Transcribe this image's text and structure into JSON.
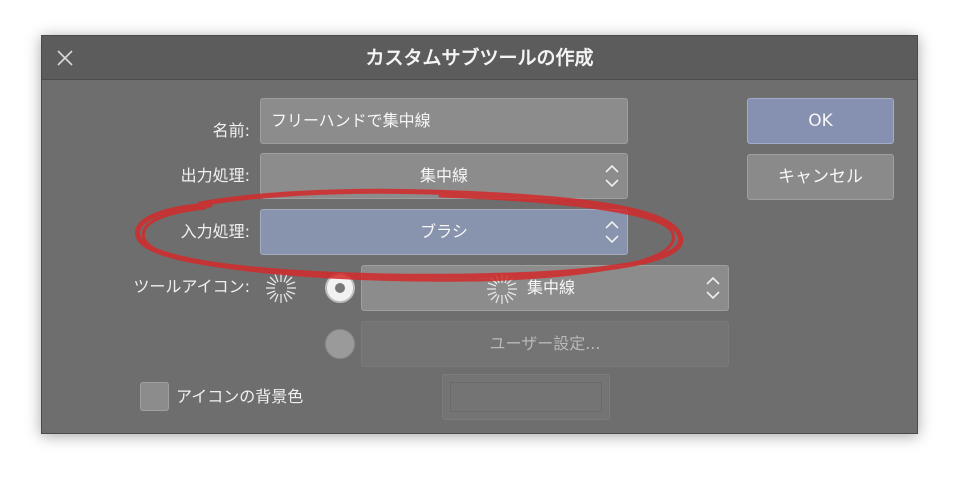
{
  "dialog": {
    "title": "カスタムサブツールの作成"
  },
  "form": {
    "name_label": "名前:",
    "name_value": "フリーハンドで集中線",
    "output_label": "出力処理:",
    "output_value": "集中線",
    "input_label": "入力処理:",
    "input_value": "ブラシ",
    "tool_icon_label": "ツールアイコン:",
    "icon_select_value": "集中線",
    "user_setting_label": "ユーザー設定...",
    "icon_bg_label": "アイコンの背景色"
  },
  "buttons": {
    "ok": "OK",
    "cancel": "キャンセル"
  },
  "icons": {
    "close": "close-icon",
    "chevron": "chevron-updown-icon",
    "focus_lines": "focus-lines-icon"
  },
  "colors": {
    "dialog_bg": "#6e6e6e",
    "titlebar_bg": "#5c5c5c",
    "primary_button": "#8690b0",
    "highlighted_field": "#8893ad",
    "annotation": "#d42a2a"
  }
}
